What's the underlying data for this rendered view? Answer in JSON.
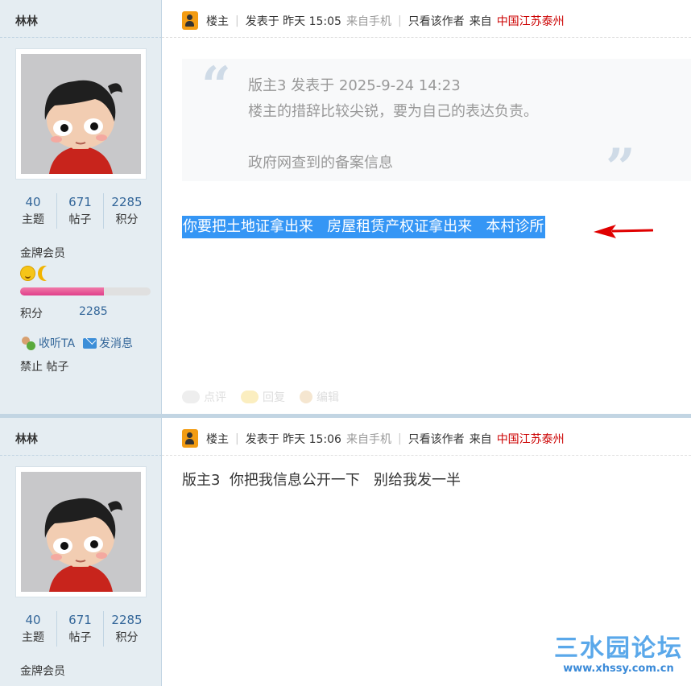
{
  "posts": [
    {
      "author": "林林",
      "stats": [
        {
          "num": "40",
          "label": "主题"
        },
        {
          "num": "671",
          "label": "帖子"
        },
        {
          "num": "2285",
          "label": "积分"
        }
      ],
      "rank": "金牌会员",
      "progress": 0.64,
      "score_label": "积分",
      "score_value": "2285",
      "action_listen": "收听TA",
      "action_msg": "发消息",
      "ban": "禁止 帖子",
      "badge": "楼主",
      "posted": "发表于 昨天 15:05",
      "from_device": "来自手机",
      "only_author": "只看该作者",
      "from_label": "来自",
      "location": "中国江苏泰州",
      "quote_header": "版主3 发表于 2025-9-24 14:23",
      "quote_line1": "楼主的措辞比较尖锐，要为自己的表达负责。",
      "quote_line2": "政府网查到的备案信息",
      "highlight": "你要把土地证拿出来   房屋租赁产权证拿出来   本村诊所",
      "footer": [
        "点评",
        "回复",
        "编辑"
      ]
    },
    {
      "author": "林林",
      "stats": [
        {
          "num": "40",
          "label": "主题"
        },
        {
          "num": "671",
          "label": "帖子"
        },
        {
          "num": "2285",
          "label": "积分"
        }
      ],
      "rank": "金牌会员",
      "badge": "楼主",
      "posted": "发表于 昨天 15:06",
      "from_device": "来自手机",
      "only_author": "只看该作者",
      "from_label": "来自",
      "location": "中国江苏泰州",
      "content": "版主3  你把我信息公开一下   别给我发一半"
    }
  ],
  "watermark": {
    "title": "三水园论坛",
    "url": "www.xhssy.com.cn"
  },
  "colors": {
    "link": "#336699",
    "location": "#cc0000",
    "selection": "#3596f5",
    "arrow": "#e00000",
    "sidebar": "#e5edf2"
  }
}
